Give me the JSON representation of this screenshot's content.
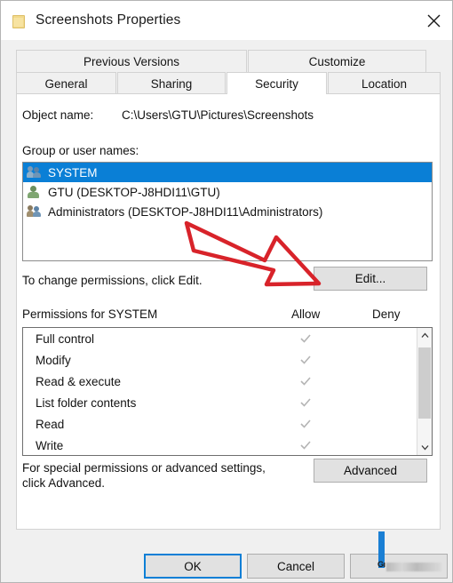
{
  "window": {
    "title": "Screenshots Properties",
    "icon": "folder-icon",
    "close_label": "✕"
  },
  "tabs": {
    "row1": [
      {
        "label": "Previous Versions",
        "active": false
      },
      {
        "label": "Customize",
        "active": false
      }
    ],
    "row2": [
      {
        "label": "General",
        "active": false
      },
      {
        "label": "Sharing",
        "active": false
      },
      {
        "label": "Security",
        "active": true
      },
      {
        "label": "Location",
        "active": false
      }
    ]
  },
  "security": {
    "object_name_label": "Object name:",
    "object_name_value": "C:\\Users\\GTU\\Pictures\\Screenshots",
    "group_label": "Group or user names:",
    "users": [
      {
        "name": "SYSTEM",
        "icon": "group-icon",
        "selected": true
      },
      {
        "name": "GTU (DESKTOP-J8HDI11\\GTU)",
        "icon": "user-icon",
        "selected": false
      },
      {
        "name": "Administrators (DESKTOP-J8HDI11\\Administrators)",
        "icon": "group-icon",
        "selected": false
      }
    ],
    "edit_note": "To change permissions, click Edit.",
    "edit_button": "Edit...",
    "permissions_title": "Permissions for SYSTEM",
    "col_allow": "Allow",
    "col_deny": "Deny",
    "permissions": [
      {
        "name": "Full control",
        "allow": "✓",
        "deny": ""
      },
      {
        "name": "Modify",
        "allow": "✓",
        "deny": ""
      },
      {
        "name": "Read & execute",
        "allow": "✓",
        "deny": ""
      },
      {
        "name": "List folder contents",
        "allow": "✓",
        "deny": ""
      },
      {
        "name": "Read",
        "allow": "✓",
        "deny": ""
      },
      {
        "name": "Write",
        "allow": "✓",
        "deny": ""
      }
    ],
    "advanced_note": "For special permissions or advanced settings, click Advanced.",
    "advanced_button": "Advanced"
  },
  "footer": {
    "ok": "OK",
    "cancel": "Cancel",
    "apply": "Gı"
  },
  "colors": {
    "selection_blue": "#0a7fd6",
    "dialog_gray": "#f0f0f0",
    "button_face": "#e1e1e1",
    "annotation_red": "#d8232a",
    "check_gray": "#b4b4b4"
  }
}
